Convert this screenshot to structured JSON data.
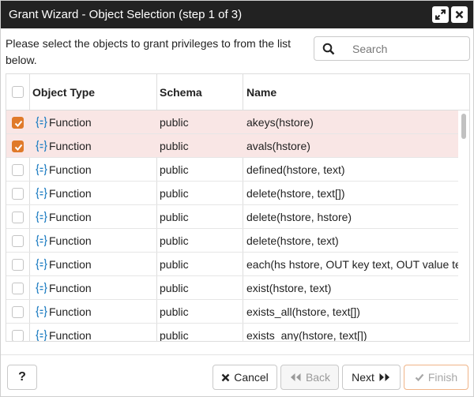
{
  "window": {
    "title": "Grant Wizard - Object Selection (step 1 of 3)"
  },
  "intro": {
    "text": "Please select the objects to grant privileges to from the list below."
  },
  "search": {
    "placeholder": "Search",
    "value": ""
  },
  "table": {
    "columns": [
      "Object Type",
      "Schema",
      "Name"
    ],
    "rows": [
      {
        "checked": true,
        "type": "Function",
        "schema": "public",
        "name": "akeys(hstore)"
      },
      {
        "checked": true,
        "type": "Function",
        "schema": "public",
        "name": "avals(hstore)"
      },
      {
        "checked": false,
        "type": "Function",
        "schema": "public",
        "name": "defined(hstore, text)"
      },
      {
        "checked": false,
        "type": "Function",
        "schema": "public",
        "name": "delete(hstore, text[])"
      },
      {
        "checked": false,
        "type": "Function",
        "schema": "public",
        "name": "delete(hstore, hstore)"
      },
      {
        "checked": false,
        "type": "Function",
        "schema": "public",
        "name": "delete(hstore, text)"
      },
      {
        "checked": false,
        "type": "Function",
        "schema": "public",
        "name": "each(hs hstore, OUT key text, OUT value text)"
      },
      {
        "checked": false,
        "type": "Function",
        "schema": "public",
        "name": "exist(hstore, text)"
      },
      {
        "checked": false,
        "type": "Function",
        "schema": "public",
        "name": "exists_all(hstore, text[])"
      },
      {
        "checked": false,
        "type": "Function",
        "schema": "public",
        "name": "exists_any(hstore, text[])"
      }
    ]
  },
  "footer": {
    "help_label": "?",
    "cancel_label": "Cancel",
    "back_label": "Back",
    "next_label": "Next",
    "finish_label": "Finish"
  },
  "colors": {
    "titlebar": "#222222",
    "accent": "#e07a2a",
    "selected_row": "#f9e6e5",
    "function_icon": "#2a84c5"
  },
  "icons": {
    "maximize": "expand-icon",
    "close": "close-icon",
    "search": "search-icon",
    "row_type": "function-icon",
    "cancel": "x-icon",
    "back": "double-chevron-left-icon",
    "next": "double-chevron-right-icon",
    "finish": "check-icon"
  }
}
